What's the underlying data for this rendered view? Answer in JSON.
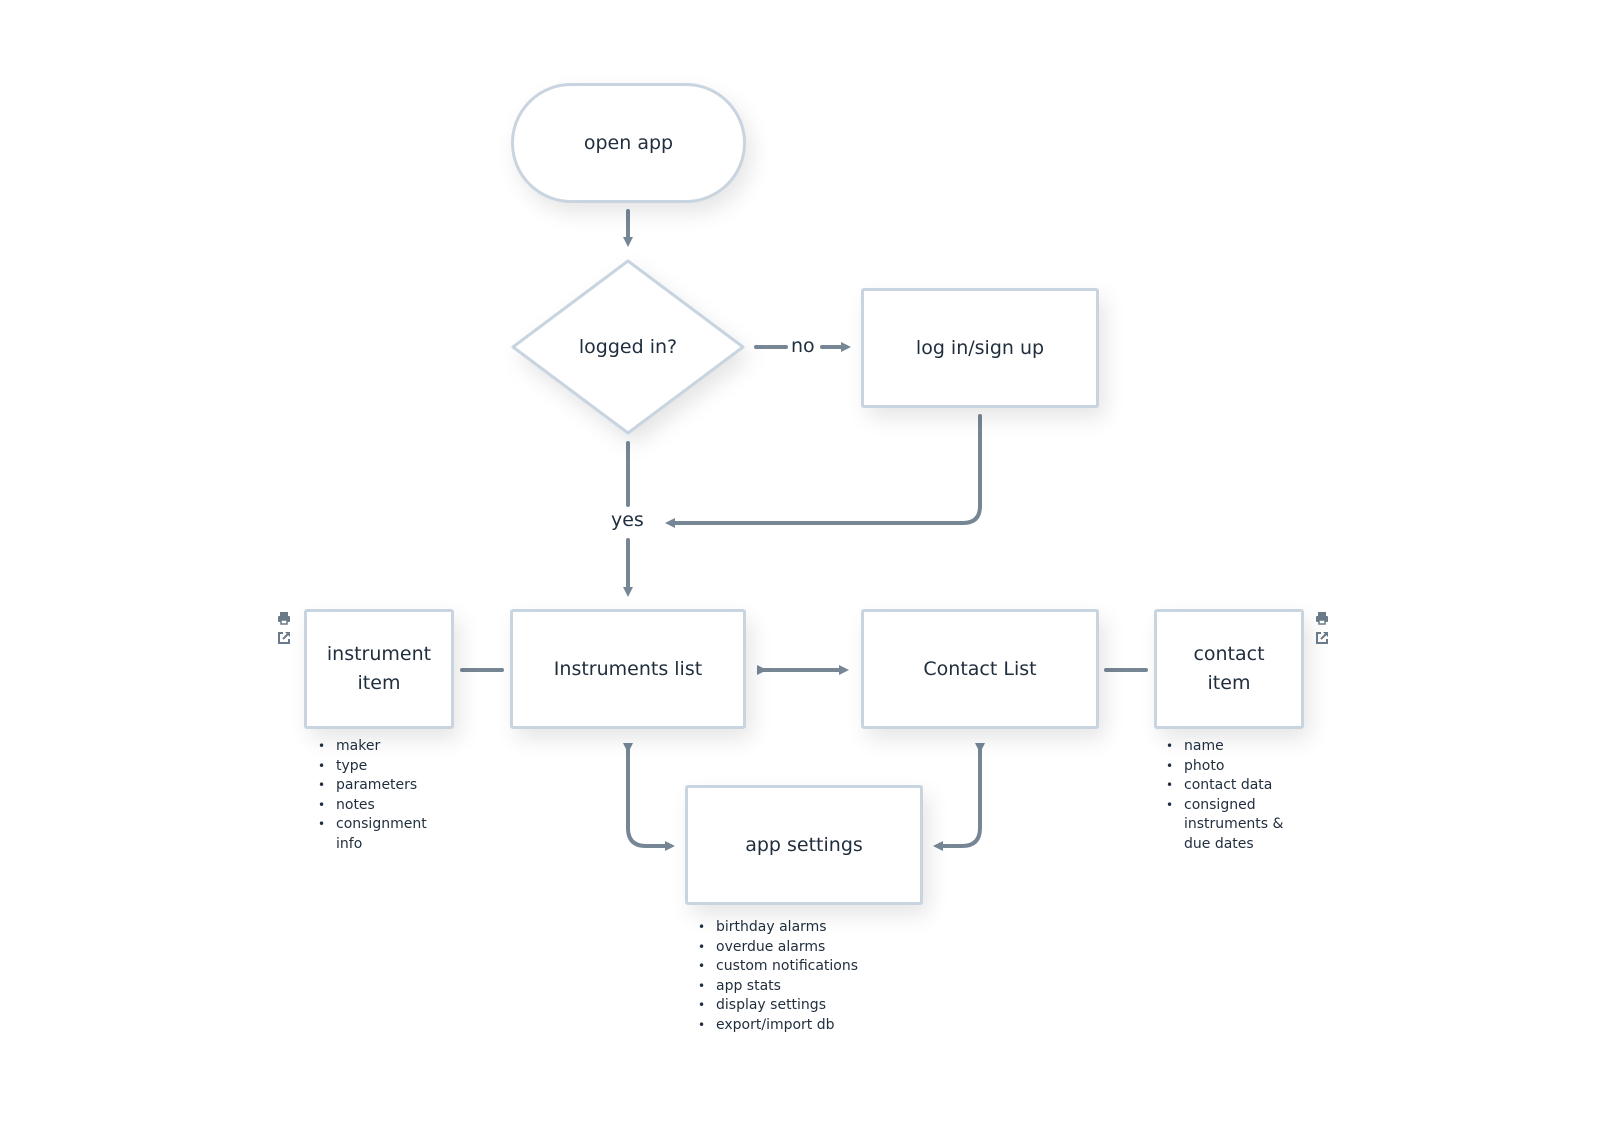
{
  "diagram": {
    "nodes": {
      "open_app": "open app",
      "logged_in": "logged in?",
      "login_signup": "log in/sign up",
      "instruments_list": "Instruments list",
      "contact_list": "Contact List",
      "instrument_item_line1": "instrument",
      "instrument_item_line2": "item",
      "contact_item_line1": "contact",
      "contact_item_line2": "item",
      "app_settings": "app settings"
    },
    "edge_labels": {
      "no": "no",
      "yes": "yes"
    },
    "notes": {
      "instrument_item": [
        "maker",
        "type",
        "parameters",
        "notes",
        "consignment info"
      ],
      "contact_item": [
        "name",
        "photo",
        "contact data",
        "consigned instruments & due dates"
      ],
      "app_settings": [
        "birthday alarms",
        "overdue alarms",
        "custom notifications",
        "app stats",
        "display settings",
        "export/import db"
      ]
    },
    "icons": {
      "instrument_item": [
        "print-icon",
        "external-link-icon"
      ],
      "contact_item": [
        "print-icon",
        "external-link-icon"
      ]
    },
    "colors": {
      "node_border": "#c8d4df",
      "connector": "#778695",
      "text": "#1f2d3d"
    }
  }
}
